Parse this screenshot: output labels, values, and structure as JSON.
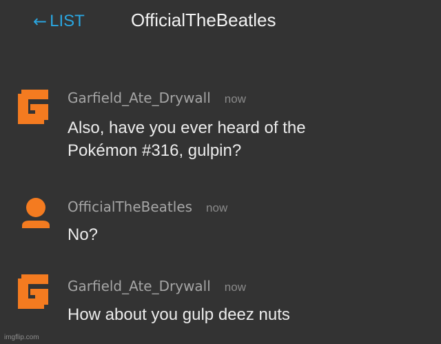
{
  "header": {
    "back_arrow": "←",
    "back_label": "LIST",
    "title": "OfficialTheBeatles"
  },
  "messages": [
    {
      "username": "Garfield_Ate_Drywall",
      "timestamp": "now",
      "text": "Also, have you ever heard of the\nPokémon #316, gulpin?",
      "avatar_icon": "garfield-g-logo-icon"
    },
    {
      "username": "OfficialTheBeatles",
      "timestamp": "now",
      "text": "No?",
      "avatar_icon": "default-user-icon"
    },
    {
      "username": "Garfield_Ate_Drywall",
      "timestamp": "now",
      "text": "How about you gulp deez nuts",
      "avatar_icon": "garfield-g-logo-icon"
    }
  ],
  "watermark": "imgflip.com",
  "colors": {
    "background": "#333333",
    "accent": "#2aa6e0",
    "avatar": "#f47b20",
    "username": "#a6a6a6",
    "message_text": "#ececec"
  }
}
